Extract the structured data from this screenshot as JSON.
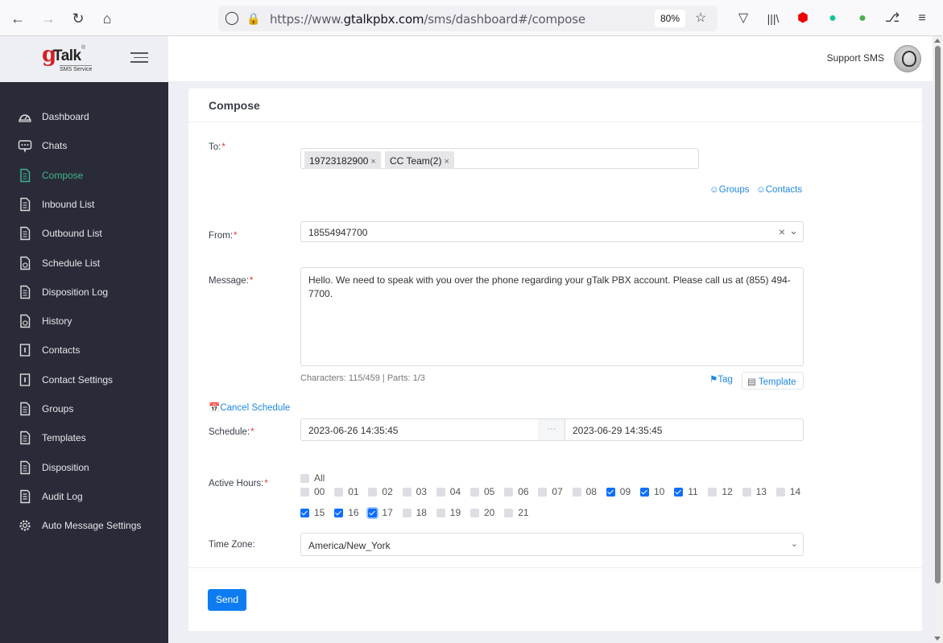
{
  "browser": {
    "url_prefix": "https://www.",
    "url_host": "gtalkpbx.com",
    "url_path": "/sms/dashboard#/compose",
    "zoom": "80%",
    "icons": [
      "back-icon",
      "forward-icon",
      "reload-icon",
      "home-icon",
      "shield-icon",
      "lock-icon",
      "bookmark-star-icon",
      "pocket-icon",
      "library-icon",
      "adblock-icon",
      "grammarly-icon",
      "chat-extension-icon",
      "extensions-icon",
      "menu-icon"
    ]
  },
  "brand": {
    "logo_g": "g",
    "logo_talk": "Talk",
    "logo_reg": "®",
    "logo_sub": "SMS Service"
  },
  "header": {
    "user_name": "Support SMS"
  },
  "sidebar": {
    "items": [
      {
        "label": "Dashboard",
        "icon": "dashboard-gauge-icon",
        "active": false
      },
      {
        "label": "Chats",
        "icon": "chat-bubble-icon",
        "active": false
      },
      {
        "label": "Compose",
        "icon": "document-icon",
        "active": true
      },
      {
        "label": "Inbound List",
        "icon": "document-icon",
        "active": false
      },
      {
        "label": "Outbound List",
        "icon": "document-icon",
        "active": false
      },
      {
        "label": "Schedule List",
        "icon": "document-clock-icon",
        "active": false
      },
      {
        "label": "Disposition Log",
        "icon": "document-icon",
        "active": false
      },
      {
        "label": "History",
        "icon": "document-clock-icon",
        "active": false
      },
      {
        "label": "Contacts",
        "icon": "contact-book-icon",
        "active": false
      },
      {
        "label": "Contact Settings",
        "icon": "contact-book-icon",
        "active": false
      },
      {
        "label": "Groups",
        "icon": "document-icon",
        "active": false
      },
      {
        "label": "Templates",
        "icon": "document-icon",
        "active": false
      },
      {
        "label": "Disposition",
        "icon": "document-icon",
        "active": false
      },
      {
        "label": "Audit Log",
        "icon": "audit-document-icon",
        "active": false
      },
      {
        "label": "Auto Message Settings",
        "icon": "gear-icon",
        "active": false
      }
    ]
  },
  "compose": {
    "title": "Compose",
    "to_label": "To:",
    "to_chips": [
      "19723182900",
      "CC Team(2)"
    ],
    "groups_link": "Groups",
    "contacts_link": "Contacts",
    "from_label": "From:",
    "from_value": "18554947700",
    "message_label": "Message:",
    "message_value": "Hello. We need to speak with you over the phone regarding your gTalk PBX account. Please call us at (855) 494-7700.",
    "char_count": "Characters: 115/459 | Parts: 1/3",
    "tag_link": "Tag",
    "template_button": "Template",
    "cancel_schedule_link": "Cancel Schedule",
    "schedule_label": "Schedule:",
    "schedule_start": "2023-06-26 14:35:45",
    "schedule_sep": "···",
    "schedule_end": "2023-06-29 14:35:45",
    "active_hours_label": "Active Hours:",
    "all_label": "All",
    "all_checked": false,
    "hours": [
      {
        "label": "00",
        "checked": false
      },
      {
        "label": "01",
        "checked": false
      },
      {
        "label": "02",
        "checked": false
      },
      {
        "label": "03",
        "checked": false
      },
      {
        "label": "04",
        "checked": false
      },
      {
        "label": "05",
        "checked": false
      },
      {
        "label": "06",
        "checked": false
      },
      {
        "label": "07",
        "checked": false
      },
      {
        "label": "08",
        "checked": false
      },
      {
        "label": "09",
        "checked": true
      },
      {
        "label": "10",
        "checked": true
      },
      {
        "label": "11",
        "checked": true
      },
      {
        "label": "12",
        "checked": false
      },
      {
        "label": "13",
        "checked": false
      },
      {
        "label": "14",
        "checked": false
      },
      {
        "label": "15",
        "checked": true
      },
      {
        "label": "16",
        "checked": true
      },
      {
        "label": "17",
        "checked": true
      },
      {
        "label": "18",
        "checked": false
      },
      {
        "label": "19",
        "checked": false
      },
      {
        "label": "20",
        "checked": false
      },
      {
        "label": "21",
        "checked": false
      }
    ],
    "timezone_label": "Time Zone:",
    "timezone_value": "America/New_York",
    "send_button": "Send",
    "required_mark": "*"
  }
}
